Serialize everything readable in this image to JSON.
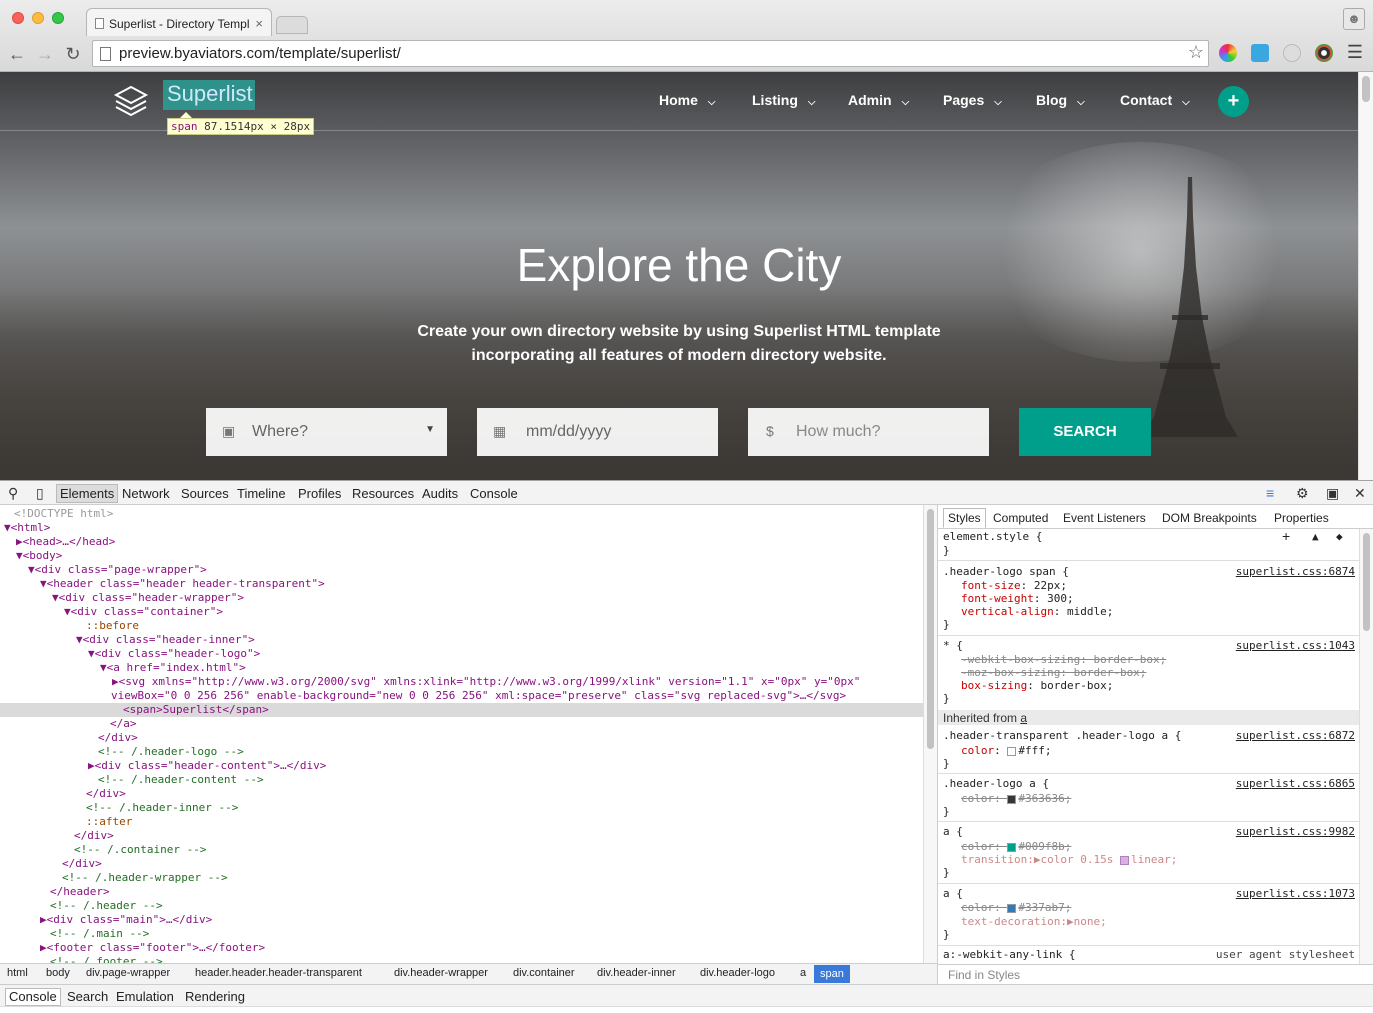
{
  "browser": {
    "tab_title": "Superlist - Directory Templ",
    "tab_close": "×",
    "url": "preview.byaviators.com/template/superlist/"
  },
  "site": {
    "logo_text": "Superlist",
    "inspect_tooltip": {
      "tag": "span",
      "size": "87.1514px × 28px"
    },
    "nav": [
      {
        "label": "Home"
      },
      {
        "label": "Listing"
      },
      {
        "label": "Admin"
      },
      {
        "label": "Pages"
      },
      {
        "label": "Blog"
      },
      {
        "label": "Contact"
      }
    ],
    "plus_label": "+",
    "hero_title": "Explore the City",
    "hero_subtitle_1": "Create your own directory website by using Superlist HTML template",
    "hero_subtitle_2": "incorporating all features of modern directory website.",
    "search": {
      "where": "Where?",
      "date": "mm/dd/yyyy",
      "price_icon": "$",
      "price": "How much?",
      "button": "SEARCH"
    }
  },
  "devtools": {
    "tabs": [
      "Elements",
      "Network",
      "Sources",
      "Timeline",
      "Profiles",
      "Resources",
      "Audits",
      "Console"
    ],
    "elements_lines": [
      {
        "d": "<!DOCTYPE html>"
      },
      {
        "d": "▼<html>"
      },
      {
        "d": "▶<head>…</head>"
      },
      {
        "d": "▼<body>"
      },
      {
        "d": "▼<div class=\"page-wrapper\">"
      },
      {
        "d": "▼<header class=\"header header-transparent\">"
      },
      {
        "d": "▼<div class=\"header-wrapper\">"
      },
      {
        "d": "▼<div class=\"container\">"
      },
      {
        "d": "::before"
      },
      {
        "d": "▼<div class=\"header-inner\">"
      },
      {
        "d": "▼<div class=\"header-logo\">"
      },
      {
        "d": "▼<a href=\"index.html\">"
      },
      {
        "d": "▶<svg xmlns=\"http://www.w3.org/2000/svg\" xmlns:xlink=\"http://www.w3.org/1999/xlink\" version=\"1.1\" x=\"0px\" y=\"0px\""
      },
      {
        "d": "viewBox=\"0 0 256 256\" enable-background=\"new 0 0 256 256\" xml:space=\"preserve\" class=\"svg replaced-svg\">…</svg>"
      },
      {
        "d": "<span>Superlist</span>"
      },
      {
        "d": "</a>"
      },
      {
        "d": "</div>"
      },
      {
        "d": "<!-- /.header-logo -->"
      },
      {
        "d": "▶<div class=\"header-content\">…</div>"
      },
      {
        "d": "<!-- /.header-content -->"
      },
      {
        "d": "</div>"
      },
      {
        "d": "<!-- /.header-inner -->"
      },
      {
        "d": "::after"
      },
      {
        "d": "</div>"
      },
      {
        "d": "<!-- /.container -->"
      },
      {
        "d": "</div>"
      },
      {
        "d": "<!-- /.header-wrapper -->"
      },
      {
        "d": "</header>"
      },
      {
        "d": "<!-- /.header -->"
      },
      {
        "d": "▶<div class=\"main\">…</div>"
      },
      {
        "d": "<!-- /.main -->"
      },
      {
        "d": "▶<footer class=\"footer\">…</footer>"
      },
      {
        "d": "<!-- /.footer -->"
      }
    ],
    "breadcrumbs": [
      "html",
      "body",
      "div.page-wrapper",
      "header.header.header-transparent",
      "div.header-wrapper",
      "div.container",
      "div.header-inner",
      "div.header-logo",
      "a",
      "span"
    ],
    "styles_tabs": [
      "Styles",
      "Computed",
      "Event Listeners",
      "DOM Breakpoints",
      "Properties"
    ],
    "styles": {
      "element_style": "element.style {",
      "close": "}",
      "r1_sel": ".header-logo span {",
      "r1_src": "superlist.css:6874",
      "r1_p1": "font-size",
      "r1_v1": "22px;",
      "r1_p2": "font-weight",
      "r1_v2": "300;",
      "r1_p3": "vertical-align",
      "r1_v3": "middle;",
      "r2_sel": "* {",
      "r2_src": "superlist.css:1043",
      "r2_l1": "-webkit-box-sizing: border-box;",
      "r2_l2": "-moz-box-sizing: border-box;",
      "r2_p3": "box-sizing",
      "r2_v3": "border-box;",
      "inherited_prefix": "Inherited from ",
      "inherited_tag": "a",
      "r3_sel": ".header-transparent .header-logo a {",
      "r3_src": "superlist.css:6872",
      "r3_p": "color",
      "r3_v": "#fff;",
      "r4_sel": ".header-logo a {",
      "r4_src": "superlist.css:6865",
      "r4_l": "color: ",
      "r4_v": "#363636;",
      "r5_sel": "a {",
      "r5_src": "superlist.css:9982",
      "r5_l": "color: ",
      "r5_v": "#009f8b;",
      "r5_p2": "transition",
      "r5_v2": "color 0.15s",
      "r5_v2b": "linear;",
      "r6_sel": "a {",
      "r6_src": "superlist.css:1073",
      "r6_l": "color: ",
      "r6_v": "#337ab7;",
      "r6_p2": "text-decoration",
      "r6_v2": "none;",
      "r7_sel": "a:-webkit-any-link {",
      "r7_src": "user agent stylesheet",
      "find": "Find in Styles"
    },
    "drawer_tabs": [
      "Console",
      "Search",
      "Emulation",
      "Rendering"
    ]
  },
  "colors": {
    "accent": "#009f8b",
    "header_color": "#363636",
    "link": "#337ab7",
    "highlight": "#3879d9"
  }
}
